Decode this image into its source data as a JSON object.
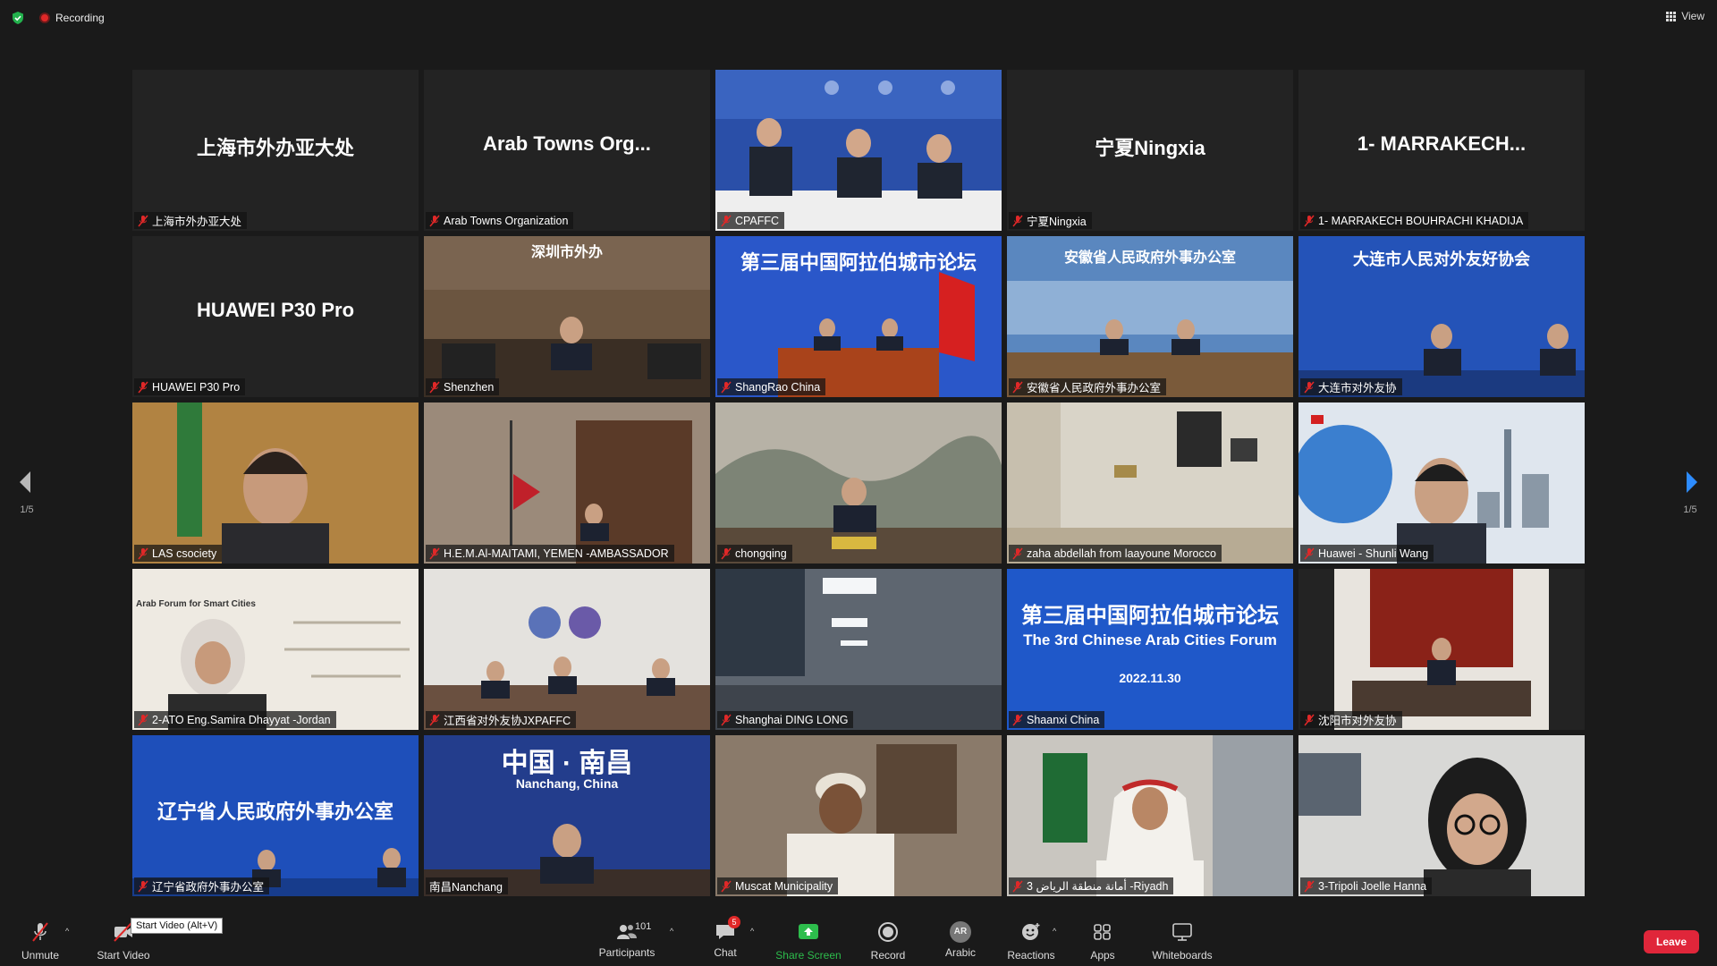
{
  "topbar": {
    "recording_label": "Recording",
    "view_label": "View"
  },
  "pagination": {
    "left": "1/5",
    "right": "1/5"
  },
  "tiles": [
    {
      "label": "上海市外办亚大处",
      "bigname": "上海市外办亚大处"
    },
    {
      "label": "Arab Towns Organization",
      "bigname": "Arab Towns Org..."
    },
    {
      "label": "CPAFFC",
      "bigname": ""
    },
    {
      "label": "宁夏Ningxia",
      "bigname": "宁夏Ningxia"
    },
    {
      "label": "1- MARRAKECH BOUHRACHI KHADIJA",
      "bigname": "1-  MARRAKECH..."
    },
    {
      "label": "HUAWEI P30 Pro",
      "bigname": "HUAWEI P30 Pro"
    },
    {
      "label": "Shenzhen",
      "bigname": "",
      "banner": "深圳市外办"
    },
    {
      "label": "ShangRao China",
      "bigname": "",
      "banner": "第三届中国阿拉伯城市论坛"
    },
    {
      "label": "安徽省人民政府外事办公室",
      "bigname": "",
      "banner": "安徽省人民政府外事办公室"
    },
    {
      "label": "大连市对外友协",
      "bigname": "",
      "banner": "大连市人民对外友好协会"
    },
    {
      "label": "LAS csociety",
      "bigname": ""
    },
    {
      "label": "H.E.M.Al-MAITAMI, YEMEN -AMBASSADOR",
      "bigname": ""
    },
    {
      "label": "chongqing",
      "bigname": ""
    },
    {
      "label": "zaha abdellah from laayoune Morocco",
      "bigname": ""
    },
    {
      "label": "Huawei - Shunli Wang",
      "bigname": ""
    },
    {
      "label": "2-ATO Eng.Samira Dhayyat -Jordan",
      "bigname": "",
      "banner": "Arab Forum for Smart Cities"
    },
    {
      "label": "江西省对外友协JXPAFFC",
      "bigname": ""
    },
    {
      "label": "Shanghai DING LONG",
      "bigname": ""
    },
    {
      "label": "Shaanxi China",
      "bigname": "",
      "banner": "第三届中国阿拉伯城市论坛",
      "banner2": "The 3rd Chinese Arab Cities Forum",
      "banner3": "2022.11.30"
    },
    {
      "label": "沈阳市对外友协",
      "bigname": ""
    },
    {
      "label": "辽宁省政府外事办公室",
      "bigname": "",
      "banner": "辽宁省人民政府外事办公室"
    },
    {
      "label": "南昌Nanchang",
      "bigname": "",
      "banner": "中国 · 南昌",
      "banner2": "Nanchang, China"
    },
    {
      "label": "Muscat Municipality",
      "bigname": ""
    },
    {
      "label": "3 أمانة منطقة الرياض -Riyadh",
      "bigname": ""
    },
    {
      "label": "3-Tripoli Joelle Hanna",
      "bigname": ""
    }
  ],
  "toolbar": {
    "unmute": "Unmute",
    "start_video": "Start Video",
    "start_video_tooltip": "Start Video (Alt+V)",
    "participants": "Participants",
    "participants_count": "101",
    "chat": "Chat",
    "chat_badge": "5",
    "share_screen": "Share Screen",
    "record": "Record",
    "language": "Arabic",
    "language_badge": "AR",
    "reactions": "Reactions",
    "apps": "Apps",
    "whiteboards": "Whiteboards",
    "leave": "Leave"
  },
  "colors": {
    "share_green": "#2dbd4c",
    "leave_red": "#e0263a",
    "active_speaker": "#d8e23a"
  }
}
